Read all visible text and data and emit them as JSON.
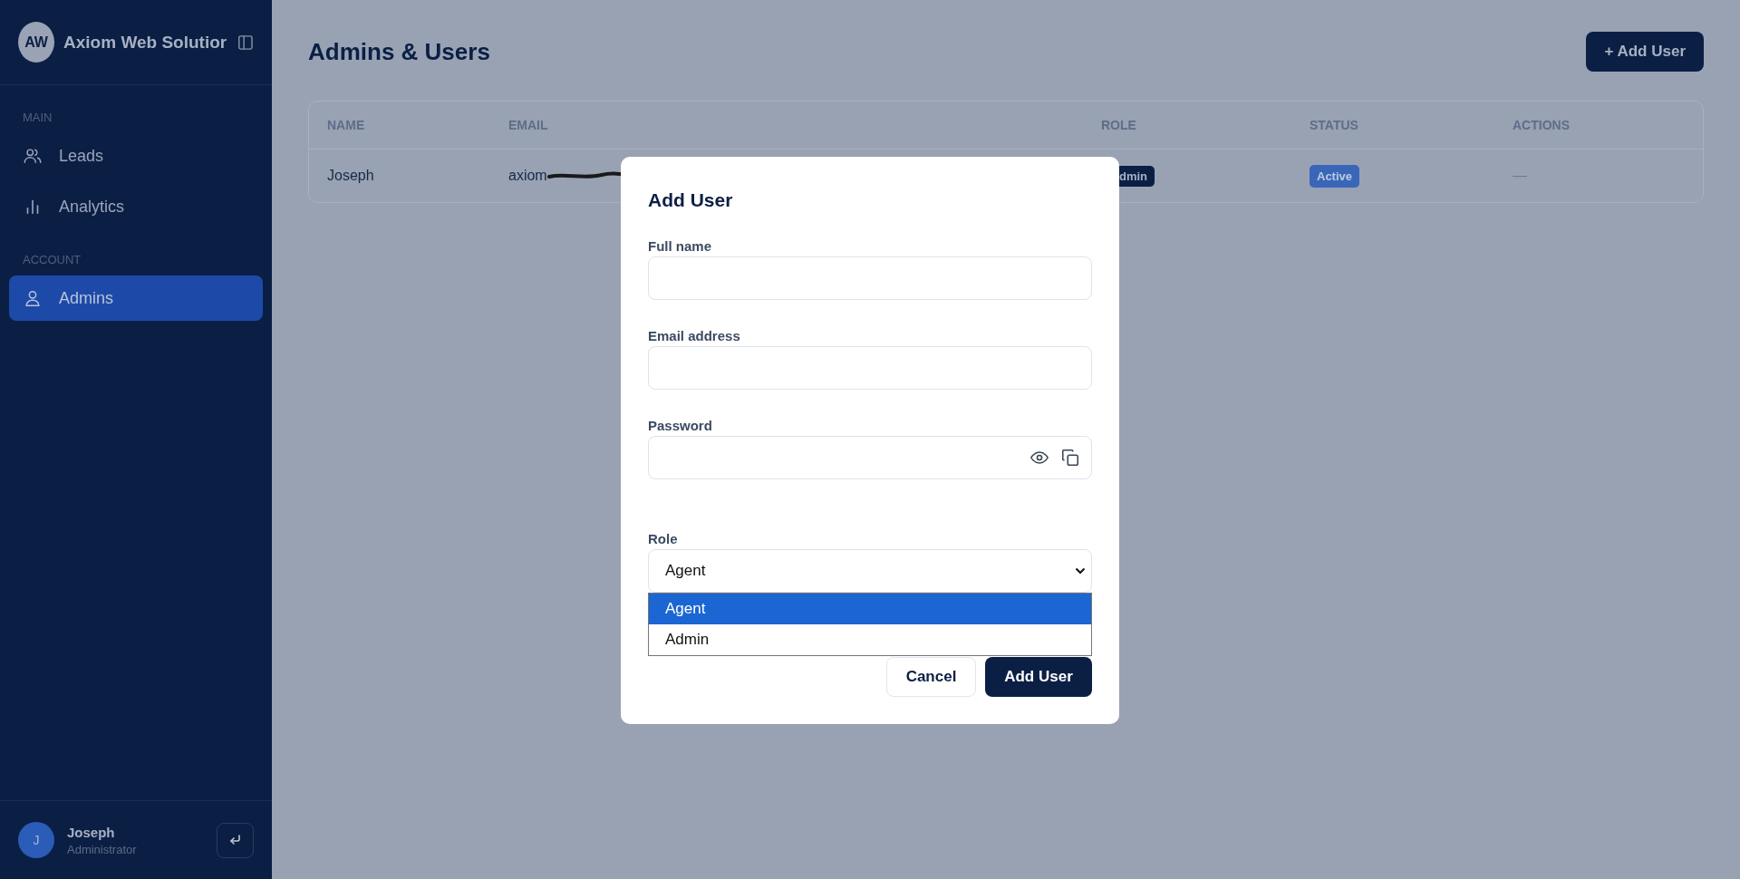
{
  "sidebar": {
    "brand": {
      "initials": "AW",
      "name": "Axiom Web Solutior"
    },
    "sections": [
      {
        "title": "MAIN",
        "items": [
          {
            "label": "Leads",
            "selected": false
          },
          {
            "label": "Analytics",
            "selected": false
          }
        ]
      },
      {
        "title": "ACCOUNT",
        "items": [
          {
            "label": "Admins",
            "selected": true
          }
        ]
      }
    ],
    "user": {
      "initial": "J",
      "name": "Joseph",
      "role": "Administrator"
    }
  },
  "page": {
    "title": "Admins & Users",
    "add_button": "+ Add User"
  },
  "table": {
    "columns": [
      "NAME",
      "EMAIL",
      "ROLE",
      "STATUS",
      "ACTIONS"
    ],
    "rows": [
      {
        "name": "Joseph",
        "email": "axiom",
        "role": "dmin",
        "status": "Active",
        "actions": "—"
      }
    ]
  },
  "modal": {
    "title": "Add User",
    "fields": [
      {
        "label": "Full name",
        "kind": "text"
      },
      {
        "label": "Email address",
        "kind": "text"
      },
      {
        "label": "Password",
        "kind": "password"
      }
    ],
    "role": {
      "label": "Role",
      "value": "Agent",
      "options": [
        {
          "label": "Agent",
          "selected": true
        },
        {
          "label": "Admin",
          "selected": false
        }
      ]
    },
    "buttons": [
      {
        "label": "Cancel"
      },
      {
        "label": "Add User"
      }
    ]
  }
}
